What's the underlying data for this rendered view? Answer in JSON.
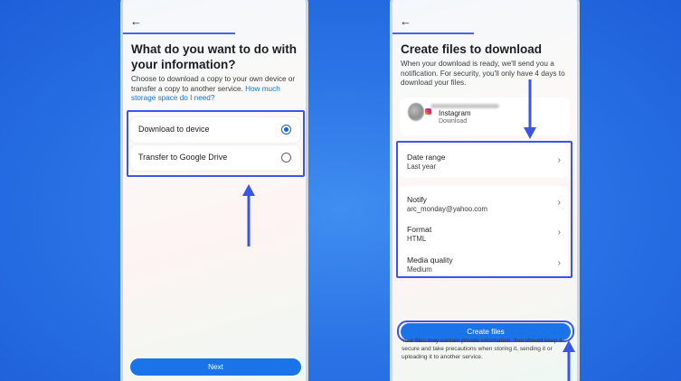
{
  "left_screen": {
    "back_icon": "arrow-left-icon",
    "title": "What do you want to do with your information?",
    "description": "Choose to download a copy to your own device or transfer a copy to another service.",
    "storage_link": "How much storage space do I need?",
    "options": [
      {
        "label": "Download to device",
        "selected": true
      },
      {
        "label": "Transfer to Google Drive",
        "selected": false
      }
    ],
    "next_button": "Next"
  },
  "right_screen": {
    "back_icon": "arrow-left-icon",
    "title": "Create files to download",
    "description": "When your download is ready, we'll send you a notification. For security, you'll only have 4 days to download your files.",
    "account": {
      "platform": "Instagram",
      "action": "Download"
    },
    "rows": [
      {
        "label": "Date range",
        "value": "Last year"
      },
      {
        "label": "Notify",
        "value": "arc_monday@yahoo.com"
      },
      {
        "label": "Format",
        "value": "HTML"
      },
      {
        "label": "Media quality",
        "value": "Medium"
      }
    ],
    "create_button": "Create files",
    "disclaimer": "Your files may contain private information. You should keep it secure and take precautions when storing it, sending it or uploading it to another service."
  },
  "colors": {
    "background": "#2b74e6",
    "annotation": "#3a55e8",
    "primary": "#1a73e8",
    "link": "#1a73c9"
  }
}
